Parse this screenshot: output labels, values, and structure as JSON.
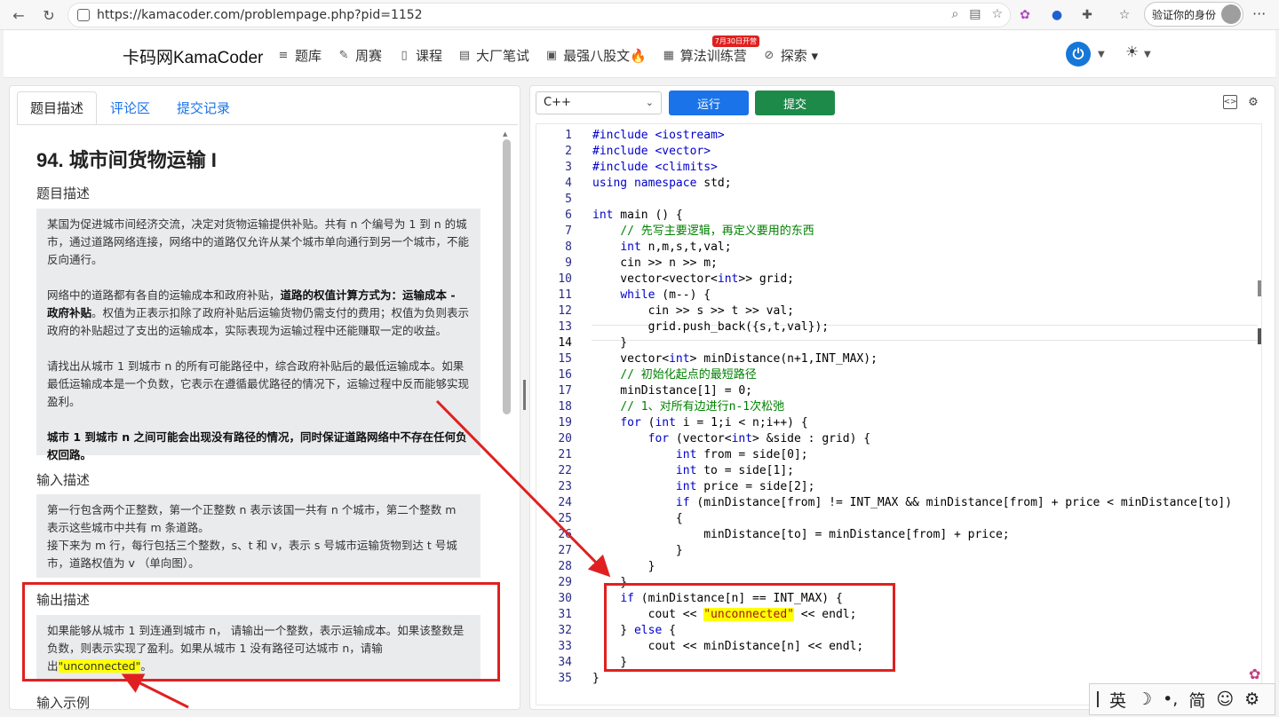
{
  "browser": {
    "url": "https://kamacoder.com/problempage.php?pid=1152",
    "profile_button": "验证你的身份",
    "colors": {
      "accent": "#1a73e8"
    }
  },
  "site": {
    "brand": "卡码网KamaCoder",
    "nav": [
      {
        "label": "题库",
        "icon": "list-icon"
      },
      {
        "label": "周赛",
        "icon": "pencil-icon"
      },
      {
        "label": "课程",
        "icon": "book-icon"
      },
      {
        "label": "大厂笔试",
        "icon": "document-icon"
      },
      {
        "label": "最强八股文🔥",
        "icon": "notebook-icon"
      },
      {
        "label": "算法训练营",
        "icon": "calendar-icon",
        "badge": "7月30日开营"
      },
      {
        "label": "探索 ▾",
        "icon": "compass-icon"
      }
    ]
  },
  "tabs": [
    "题目描述",
    "评论区",
    "提交记录"
  ],
  "problem": {
    "title": "94. 城市间货物运输 I",
    "desc_title": "题目描述",
    "desc_p1": "某国为促进城市间经济交流，决定对货物运输提供补贴。共有 n 个编号为 1 到 n 的城市，通过道路网络连接，网络中的道路仅允许从某个城市单向通行到另一个城市，不能反向通行。",
    "desc_p2_a": "网络中的道路都有各自的运输成本和政府补贴，",
    "desc_p2_b": "道路的权值计算方式为：运输成本 - 政府补贴",
    "desc_p2_c": "。权值为正表示扣除了政府补贴后运输货物仍需支付的费用；权值为负则表示政府的补贴超过了支出的运输成本，实际表现为运输过程中还能赚取一定的收益。",
    "desc_p3": "请找出从城市 1 到城市 n 的所有可能路径中，综合政府补贴后的最低运输成本。如果最低运输成本是一个负数，它表示在遵循最优路径的情况下，运输过程中反而能够实现盈利。",
    "desc_p4": "城市 1 到城市 n 之间可能会出现没有路径的情况，同时保证道路网络中不存在任何负权回路。",
    "input_title": "输入描述",
    "input_text": "第一行包含两个正整数，第一个正整数 n 表示该国一共有 n 个城市，第二个整数 m 表示这些城市中共有 m 条道路。",
    "input_text2": "接下来为 m 行，每行包括三个整数，s、t 和 v，表示 s 号城市运输货物到达 t 号城市，道路权值为 v （单向图）。",
    "output_title": "输出描述",
    "output_text": "如果能够从城市 1 到连通到城市 n， 请输出一个整数，表示运输成本。如果该整数是负数，则表示实现了盈利。如果从城市 1 没有路径可达城市 n，请输出",
    "output_hl": "\"unconnected\"",
    "output_end": "。",
    "example_title": "输入示例"
  },
  "editor": {
    "language": "C++",
    "run": "运行",
    "submit": "提交",
    "current_line": 14,
    "lines": [
      "#include <iostream>",
      "#include <vector>",
      "#include <climits>",
      "using namespace std;",
      "",
      "int main () {",
      "    // 先写主要逻辑，再定义要用的东西",
      "    int n,m,s,t,val;",
      "    cin >> n >> m;",
      "    vector<vector<int>> grid;",
      "    while (m--) {",
      "        cin >> s >> t >> val;",
      "        grid.push_back({s,t,val});",
      "    }",
      "    vector<int> minDistance(n+1,INT_MAX);",
      "    // 初始化起点的最短路径",
      "    minDistance[1] = 0;",
      "    // 1、对所有边进行n-1次松弛",
      "    for (int i = 1;i < n;i++) {",
      "        for (vector<int> &side : grid) {",
      "            int from = side[0];",
      "            int to = side[1];",
      "            int price = side[2];",
      "            if (minDistance[from] != INT_MAX && minDistance[from] + price < minDistance[to])",
      "            {",
      "                minDistance[to] = minDistance[from] + price;",
      "            }",
      "        }",
      "    }",
      "    if (minDistance[n] == INT_MAX) {",
      "        cout << \"unconnected\" << endl;",
      "    } else {",
      "        cout << minDistance[n] << endl;",
      "    }",
      "}"
    ]
  },
  "ime": {
    "items": [
      "英",
      "☽",
      "•,",
      "简",
      "☺",
      "⚙"
    ]
  }
}
